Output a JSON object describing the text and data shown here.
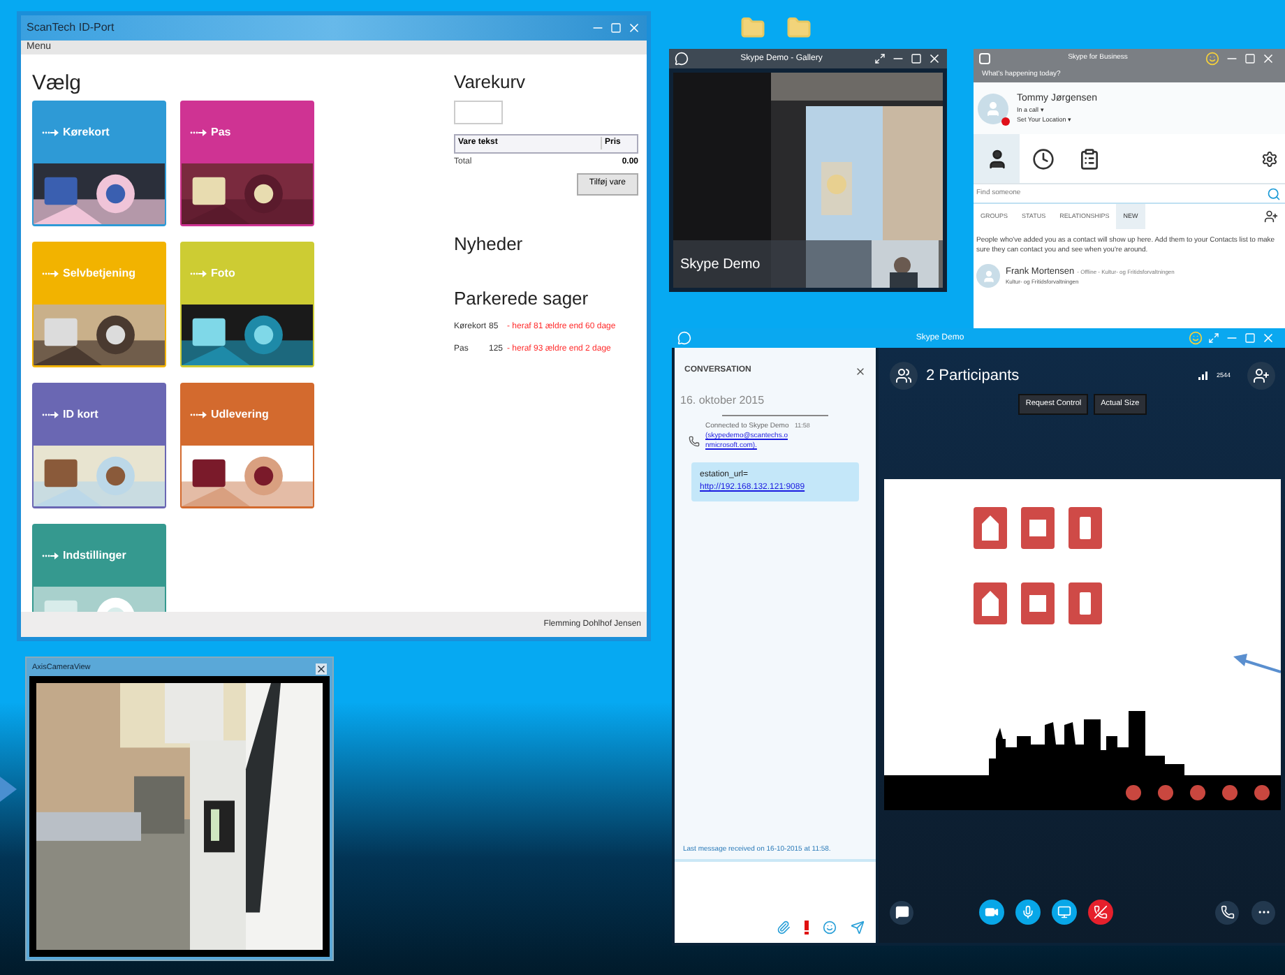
{
  "scantech_window": {
    "title": "ScanTech ID-Port",
    "menu": "Menu",
    "heading": "Vælg",
    "tiles": [
      {
        "label": "Kørekort",
        "color": "#2e9ad6"
      },
      {
        "label": "Pas",
        "color": "#cf3393"
      },
      {
        "label": "Selvbetjening",
        "color": "#f2b300"
      },
      {
        "label": "Foto",
        "color": "#cdcc33"
      },
      {
        "label": "ID kort",
        "color": "#6a67b3"
      },
      {
        "label": "Udlevering",
        "color": "#d36a2e"
      },
      {
        "label": "Indstillinger",
        "color": "#35998f"
      }
    ],
    "cart": {
      "heading": "Varekurv",
      "columns": [
        "Vare tekst",
        "Pris"
      ],
      "total_label": "Total",
      "total_value": "0.00",
      "button": "Tilføj vare"
    },
    "news_heading": "Nyheder",
    "parked": {
      "heading": "Parkerede sager",
      "rows": [
        {
          "name": "Kørekort",
          "count": "85",
          "note": "- heraf 81 ældre end 60 dage"
        },
        {
          "name": "Pas",
          "count": "125",
          "note": "- heraf 93 ældre end 2 dage"
        }
      ]
    },
    "user": "Flemming Dohlhof Jensen"
  },
  "gallery_window": {
    "title": "Skype Demo - Gallery",
    "caption": "Skype Demo"
  },
  "sfb_window": {
    "title": "Skype for Business",
    "banner": "What's happening today?",
    "user": {
      "name": "Tommy Jørgensen",
      "status": "In a call ▾",
      "location": "Set Your Location ▾"
    },
    "nav_tabs": [
      {
        "kind": "contacts",
        "selected": true
      },
      {
        "kind": "recent",
        "selected": false
      },
      {
        "kind": "meetings",
        "selected": false
      }
    ],
    "search": {
      "placeholder": "Find someone"
    },
    "filter_tabs": [
      {
        "label": "GROUPS",
        "selected": false
      },
      {
        "label": "STATUS",
        "selected": false
      },
      {
        "label": "RELATIONSHIPS",
        "selected": false
      },
      {
        "label": "NEW",
        "selected": true
      }
    ],
    "message": "People who've added you as a contact will show up here. Add them to your Contacts list to make sure they can contact you and see when you're around.",
    "contact": {
      "name": "Frank Mortensen",
      "status": "- Offline - Kultur- og Fritidsforvaltningen",
      "department": "Kultur- og Fritidsforvaltningen"
    }
  },
  "meeting_window": {
    "title": "Skype Demo",
    "conversation": {
      "heading": "CONVERSATION",
      "date": "16. oktober 2015",
      "system_text": "Connected to Skype Demo",
      "system_link": "(skypedemo@scantechs.onmicrosoft.com).",
      "time": "11:58",
      "message_prefix": "estation_url=",
      "message_link": "http://192.168.132.121:9089",
      "footer": "Last message received on 16-10-2015 at 11:58."
    },
    "stage": {
      "participants": "2 Participants",
      "signal_reading": "2544",
      "buttons": [
        "Request Control",
        "Actual Size"
      ]
    }
  },
  "camera_window": {
    "title": "AxisCameraView"
  }
}
